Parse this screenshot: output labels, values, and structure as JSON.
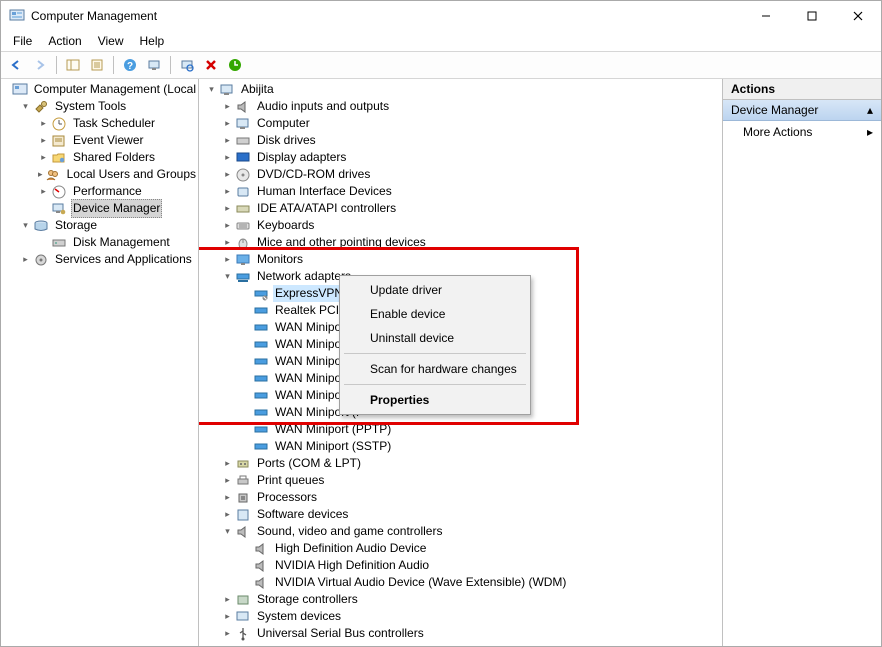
{
  "window": {
    "title": "Computer Management"
  },
  "menus": {
    "file": "File",
    "action": "Action",
    "view": "View",
    "help": "Help"
  },
  "left_tree": {
    "root": "Computer Management (Local",
    "system_tools": "System Tools",
    "task_scheduler": "Task Scheduler",
    "event_viewer": "Event Viewer",
    "shared_folders": "Shared Folders",
    "local_users": "Local Users and Groups",
    "performance": "Performance",
    "device_manager": "Device Manager",
    "storage": "Storage",
    "disk_management": "Disk Management",
    "services_apps": "Services and Applications"
  },
  "device_tree": {
    "computer": "Abijita",
    "audio_io": "Audio inputs and outputs",
    "computer_cat": "Computer",
    "disk_drives": "Disk drives",
    "display_adapters": "Display adapters",
    "dvd": "DVD/CD-ROM drives",
    "hid": "Human Interface Devices",
    "ide": "IDE ATA/ATAPI controllers",
    "keyboards": "Keyboards",
    "mice": "Mice and other pointing devices",
    "monitors": "Monitors",
    "net_adapters": "Network adapters",
    "net_children": {
      "expressvpn": "ExpressVPN TAP Adapter",
      "realtek": "Realtek PCIe GbE",
      "wan1": "WAN Miniport (I",
      "wan2": "WAN Miniport (I",
      "wan3": "WAN Miniport (I",
      "wan4": "WAN Miniport (I",
      "wan5": "WAN Miniport (I",
      "wan6": "WAN Miniport (I",
      "wan_pptp": "WAN Miniport (PPTP)",
      "wan_sstp": "WAN Miniport (SSTP)"
    },
    "ports": "Ports (COM & LPT)",
    "print_queues": "Print queues",
    "processors": "Processors",
    "software_devices": "Software devices",
    "sound": "Sound, video and game controllers",
    "sound_children": {
      "hd_audio": "High Definition Audio Device",
      "nvidia_audio": "NVIDIA High Definition Audio",
      "nvidia_virtual": "NVIDIA Virtual Audio Device (Wave Extensible) (WDM)"
    },
    "storage_ctl": "Storage controllers",
    "system_devices": "System devices",
    "usb": "Universal Serial Bus controllers"
  },
  "context_menu": {
    "update_driver": "Update driver",
    "enable_device": "Enable device",
    "uninstall": "Uninstall device",
    "scan": "Scan for hardware changes",
    "properties": "Properties"
  },
  "actions": {
    "header": "Actions",
    "group": "Device Manager",
    "more": "More Actions"
  }
}
